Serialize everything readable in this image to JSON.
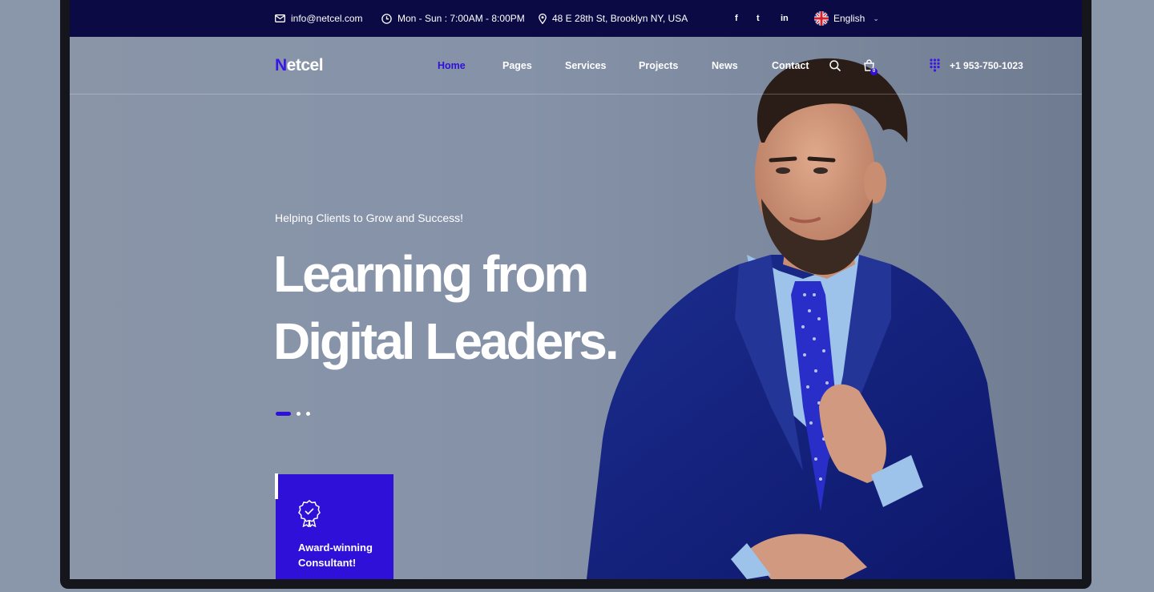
{
  "topbar": {
    "email": "info@netcel.com",
    "hours": "Mon - Sun : 7:00AM - 8:00PM",
    "address": "48 E 28th St, Brooklyn NY, USA",
    "social": [
      "f",
      "t",
      "in"
    ],
    "language": "English"
  },
  "nav": {
    "logo_initial": "N",
    "logo_rest": "etcel",
    "items": [
      "Home",
      "Pages",
      "Services",
      "Projects",
      "News",
      "Contact"
    ],
    "active_item": "Home",
    "cart_count": "0",
    "phone": "+1 953-750-1023"
  },
  "hero": {
    "subtitle": "Helping Clients to Grow and Success!",
    "headline_line1": "Learning from",
    "headline_line2": "Digital Leaders.",
    "slides_total": 3,
    "active_slide": 1
  },
  "award": {
    "text": "Award-winning Consultant!"
  },
  "colors": {
    "accent": "#2f10d8",
    "topbar_bg": "#0b0a44",
    "hero_bg": "#8592a8"
  },
  "icons": [
    "envelope-icon",
    "clock-icon",
    "map-pin-icon",
    "uk-flag-icon",
    "search-icon",
    "shopping-bag-icon",
    "dial-pad-icon",
    "award-badge-icon"
  ]
}
